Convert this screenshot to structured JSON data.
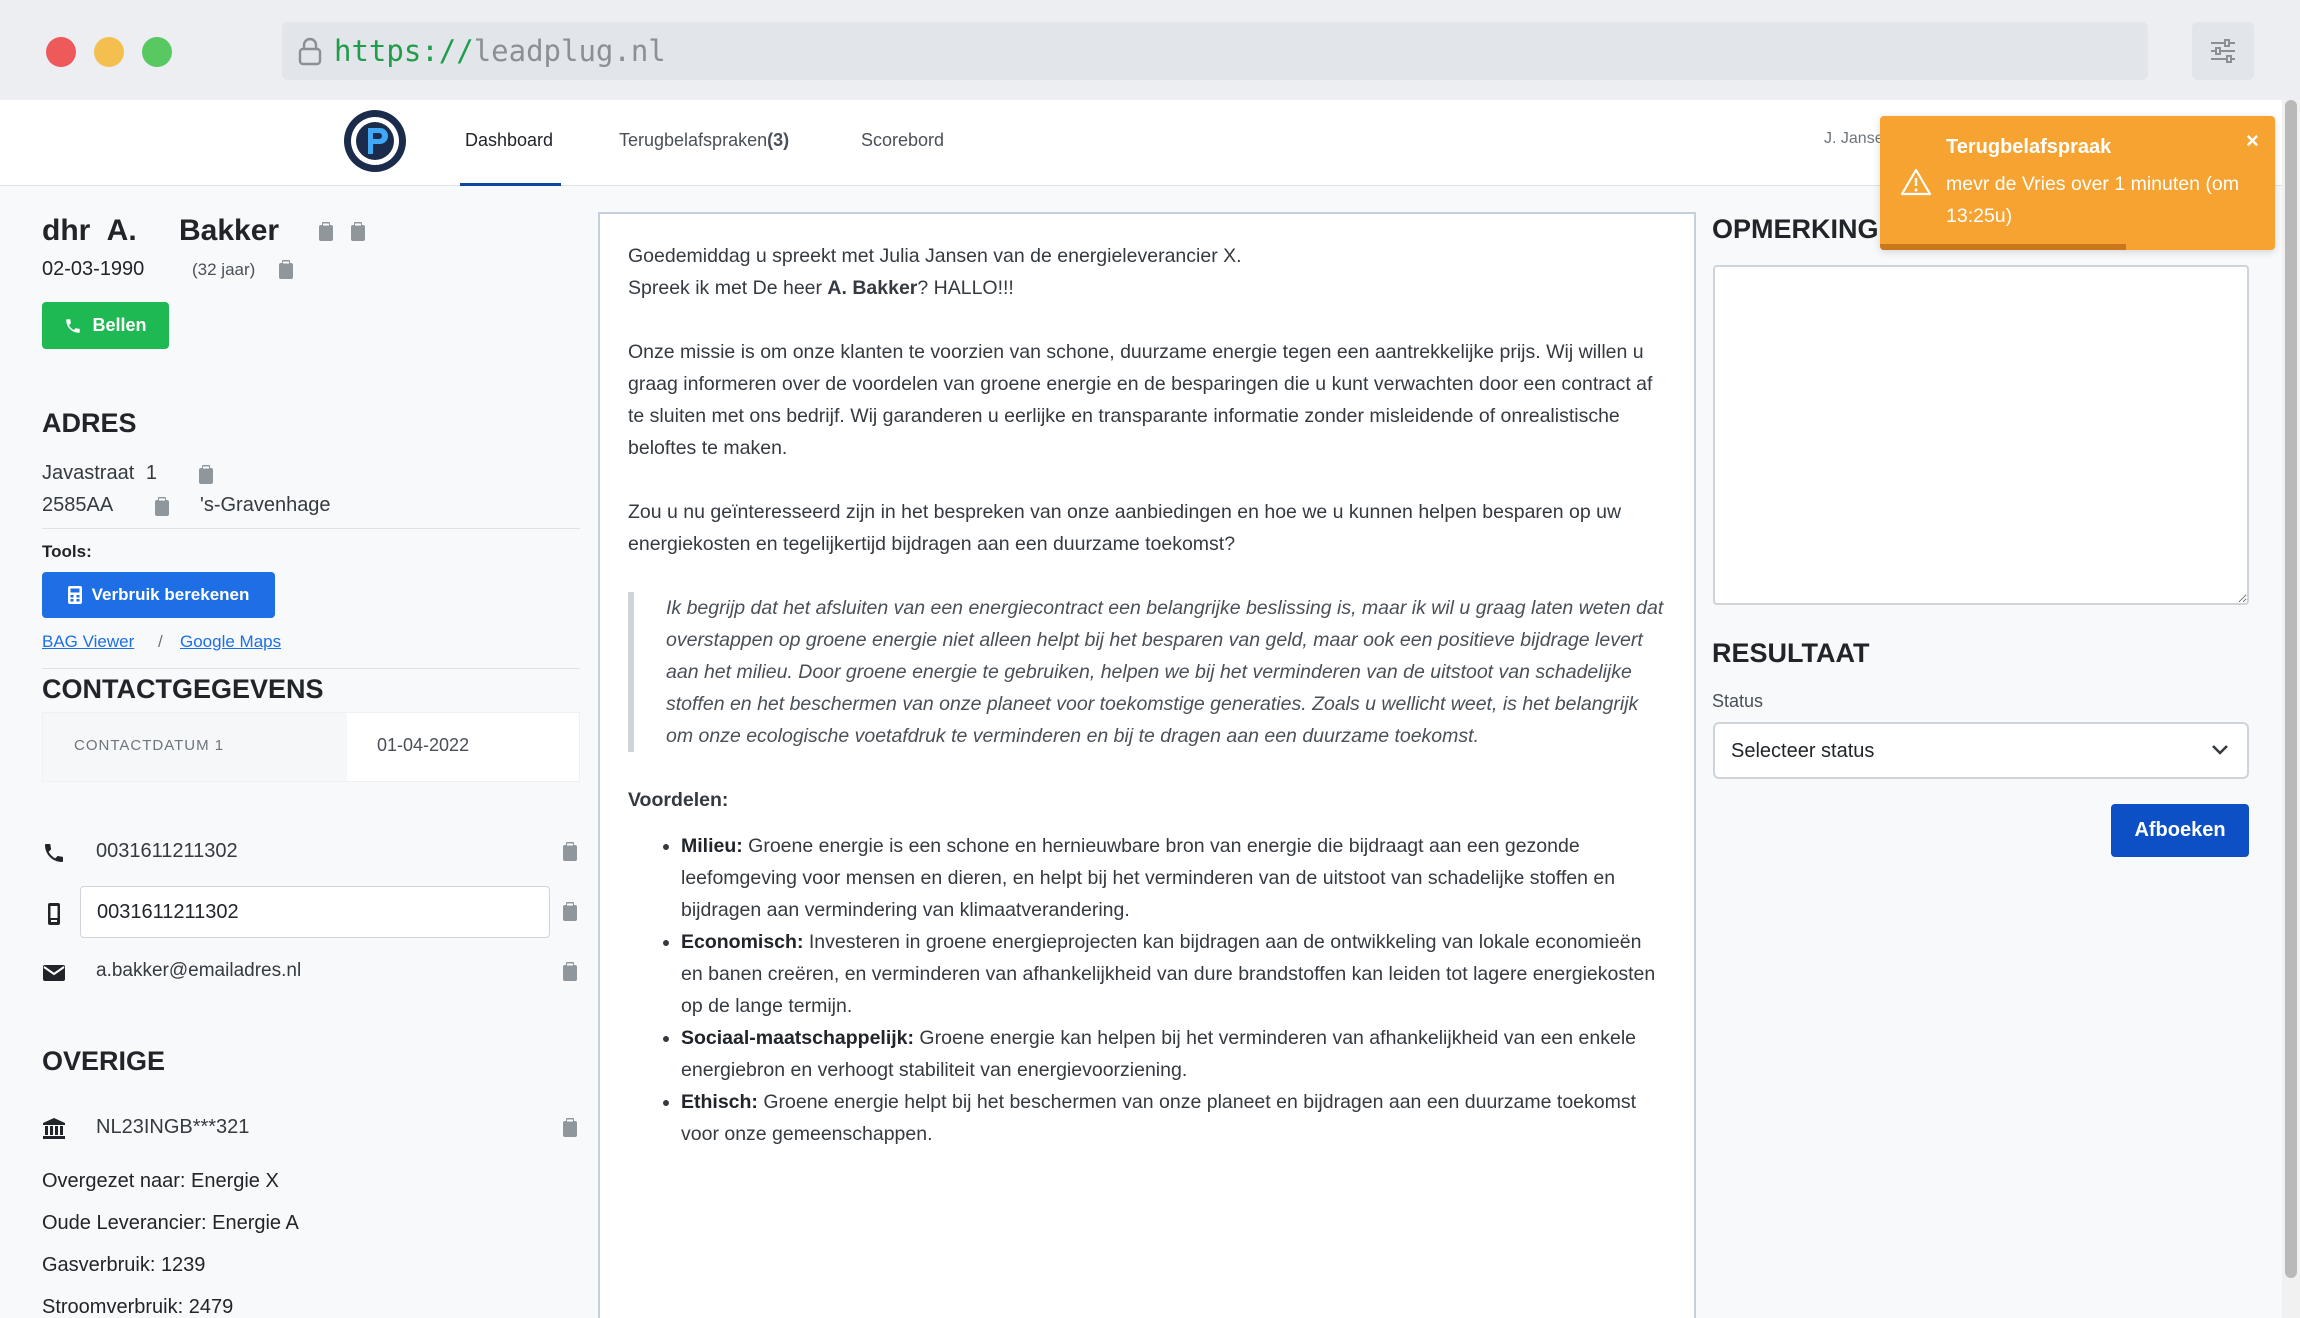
{
  "browser": {
    "url_scheme": "https://",
    "url_host": "leadplug.nl"
  },
  "nav": {
    "items": [
      {
        "label": "Dashboard",
        "active": true
      },
      {
        "label": "Terugbelafspraken",
        "count": "(3)"
      },
      {
        "label": "Scorebord"
      }
    ],
    "user": "J. Jansen"
  },
  "lead": {
    "salutation": "dhr",
    "initials": "A.",
    "lastname": "Bakker",
    "dob": "02-03-1990",
    "age": "(32 jaar)",
    "call_label": "Bellen"
  },
  "address": {
    "title": "ADRES",
    "street": "Javastraat",
    "number": "1",
    "postcode": "2585AA",
    "city": "'s-Gravenhage",
    "tools_label": "Tools:",
    "usage_button": "Verbruik berekenen",
    "link_bag": "BAG Viewer",
    "link_sep": "/",
    "link_maps": "Google Maps"
  },
  "contact": {
    "title": "CONTACTGEGEVENS",
    "date_label": "CONTACTDATUM 1",
    "date_value": "01-04-2022",
    "phone": "0031611211302",
    "mobile": "0031611211302",
    "email": "a.bakker@emailadres.nl"
  },
  "other": {
    "title": "OVERIGE",
    "iban": "NL23INGB***321",
    "lines": [
      {
        "label": "Overgezet naar:",
        "value": "Energie X"
      },
      {
        "label": "Oude Leverancier:",
        "value": "Energie A"
      },
      {
        "label": "Gasverbruik:",
        "value": "1239"
      },
      {
        "label": "Stroomverbruik:",
        "value": "2479"
      }
    ]
  },
  "script": {
    "intro_1": "Goedemiddag u spreekt met Julia Jansen van de energieleverancier X.",
    "intro_2_pre": "Spreek ik met De heer ",
    "intro_2_name": "A. Bakker",
    "intro_2_post": "? HALLO!!!",
    "mission": "Onze missie is om onze klanten te voorzien van schone, duurzame energie tegen een aantrekkelijke prijs. Wij willen u graag informeren over de voordelen van groene energie en de besparingen die u kunt verwachten door een contract af te sluiten met ons bedrijf. Wij garanderen u eerlijke en transparante informatie zonder misleidende of onrealistische beloftes te maken.",
    "question": "Zou u nu geïnteresseerd zijn in het bespreken van onze aanbiedingen en hoe we u kunnen helpen besparen op uw energiekosten en tegelijkertijd bijdragen aan een duurzame toekomst?",
    "quote": "Ik begrijp dat het afsluiten van een energiecontract een belangrijke beslissing is, maar ik wil u graag laten weten dat overstappen op groene energie niet alleen helpt bij het besparen van geld, maar ook een positieve bijdrage levert aan het milieu. Door groene energie te gebruiken, helpen we bij het verminderen van de uitstoot van schadelijke stoffen en het beschermen van onze planeet voor toekomstige generaties. Zoals u wellicht weet, is het belangrijk om onze ecologische voetafdruk te verminderen en bij te dragen aan een duurzame toekomst.",
    "advantages_title": "Voordelen:",
    "advantages": [
      {
        "label": "Milieu:",
        "text": " Groene energie is een schone en hernieuwbare bron van energie die bijdraagt aan een gezonde leefomgeving voor mensen en dieren, en helpt bij het verminderen van de uitstoot van schadelijke stoffen en bijdragen aan vermindering van klimaatverandering."
      },
      {
        "label": "Economisch:",
        "text": " Investeren in groene energieprojecten kan bijdragen aan de ontwikkeling van lokale economieën en banen creëren, en verminderen van afhankelijkheid van dure brandstoffen kan leiden tot lagere energiekosten op de lange termijn."
      },
      {
        "label": "Sociaal-maatschappelijk:",
        "text": " Groene energie kan helpen bij het verminderen van afhankelijkheid van een enkele energiebron en verhoogt stabiliteit van energievoorziening."
      },
      {
        "label": "Ethisch:",
        "text": " Groene energie helpt bij het beschermen van onze planeet en bijdragen aan een duurzame toekomst voor onze gemeenschappen."
      }
    ]
  },
  "remarks": {
    "title": "OPMERKINGEN",
    "value": ""
  },
  "result": {
    "title": "RESULTAAT",
    "status_label": "Status",
    "status_placeholder": "Selecteer status",
    "book_button": "Afboeken"
  },
  "toast": {
    "title": "Terugbelafspraak",
    "message": "mevr de Vries over 1 minuten (om 13:25u)",
    "close": "×",
    "color": "#f6a332"
  }
}
